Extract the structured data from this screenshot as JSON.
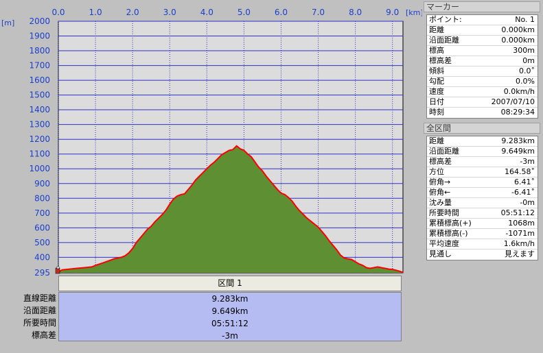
{
  "chart_data": {
    "type": "area",
    "title": "",
    "xlabel": "[km]",
    "ylabel": "[m]",
    "xlim": [
      0,
      9.283
    ],
    "ylim": [
      295,
      2000
    ],
    "x_ticks": [
      0.0,
      1.0,
      2.0,
      3.0,
      4.0,
      5.0,
      6.0,
      7.0,
      8.0,
      9.0
    ],
    "x_tick_labels": [
      "0.0",
      "1.0",
      "2.0",
      "3.0",
      "4.0",
      "5.0",
      "6.0",
      "7.0",
      "8.0",
      "9.0"
    ],
    "y_ticks": [
      295,
      400,
      500,
      600,
      700,
      800,
      900,
      1000,
      1100,
      1200,
      1300,
      1400,
      1500,
      1600,
      1700,
      1800,
      1900,
      2000
    ],
    "y_tick_labels": [
      "295",
      "400",
      "500",
      "600",
      "700",
      "800",
      "900",
      "1000",
      "1100",
      "1200",
      "1300",
      "1400",
      "1500",
      "1600",
      "1700",
      "1800",
      "1900",
      "2000"
    ],
    "grid": true,
    "fill_color": "#5e8f32",
    "line_color": "#ff0000",
    "series": [
      {
        "x": [
          0.0,
          0.1,
          0.3,
          0.5,
          0.7,
          0.9,
          1.0,
          1.2,
          1.4,
          1.5,
          1.6,
          1.7,
          1.8,
          1.9,
          2.0,
          2.1,
          2.2,
          2.3,
          2.4,
          2.5,
          2.6,
          2.7,
          2.8,
          2.9,
          3.0,
          3.1,
          3.2,
          3.3,
          3.4,
          3.5,
          3.6,
          3.7,
          3.8,
          3.9,
          4.0,
          4.1,
          4.2,
          4.3,
          4.4,
          4.5,
          4.6,
          4.7,
          4.8,
          4.9,
          5.0,
          5.1,
          5.2,
          5.3,
          5.4,
          5.5,
          5.6,
          5.7,
          5.8,
          5.9,
          6.0,
          6.1,
          6.2,
          6.3,
          6.4,
          6.5,
          6.6,
          6.7,
          6.8,
          6.9,
          7.0,
          7.1,
          7.2,
          7.3,
          7.4,
          7.5,
          7.6,
          7.7,
          7.8,
          7.9,
          8.0,
          8.1,
          8.2,
          8.3,
          8.4,
          8.5,
          8.6,
          8.7,
          8.8,
          8.9,
          9.0,
          9.1,
          9.2,
          9.283
        ],
        "y": [
          300,
          315,
          320,
          325,
          330,
          335,
          345,
          362,
          380,
          390,
          395,
          400,
          410,
          430,
          460,
          500,
          530,
          560,
          590,
          610,
          640,
          665,
          690,
          720,
          760,
          795,
          815,
          825,
          830,
          860,
          890,
          925,
          950,
          975,
          1000,
          1025,
          1045,
          1070,
          1095,
          1110,
          1125,
          1130,
          1155,
          1135,
          1125,
          1100,
          1080,
          1045,
          1010,
          985,
          950,
          920,
          890,
          860,
          835,
          825,
          805,
          780,
          745,
          715,
          690,
          665,
          645,
          625,
          605,
          575,
          545,
          510,
          480,
          450,
          415,
          395,
          390,
          385,
          370,
          355,
          345,
          330,
          325,
          330,
          335,
          330,
          325,
          320,
          318,
          312,
          305,
          297
        ]
      }
    ]
  },
  "section": {
    "header": "区間 1",
    "rows": [
      {
        "label": "直線距離",
        "value": "9.283km"
      },
      {
        "label": "沿面距離",
        "value": "9.649km"
      },
      {
        "label": "所要時間",
        "value": "05:51:12"
      },
      {
        "label": "標高差",
        "value": "-3m"
      }
    ]
  },
  "marker": {
    "title": "マーカー",
    "rows": [
      {
        "label": "ポイント:",
        "value": "No. 1"
      },
      {
        "label": "距離",
        "value": "0.000km"
      },
      {
        "label": "沿面距離",
        "value": "0.000km"
      },
      {
        "label": "標高",
        "value": "300m"
      },
      {
        "label": "標高差",
        "value": "0m"
      },
      {
        "label": "傾斜",
        "value": "0.0˚"
      },
      {
        "label": "勾配",
        "value": "0.0%"
      },
      {
        "label": "速度",
        "value": "0.0km/h"
      },
      {
        "label": "日付",
        "value": "2007/07/10"
      },
      {
        "label": "時刻",
        "value": "08:29:34"
      }
    ]
  },
  "total": {
    "title": "全区間",
    "rows": [
      {
        "label": "距離",
        "value": "9.283km"
      },
      {
        "label": "沿面距離",
        "value": "9.649km"
      },
      {
        "label": "標高差",
        "value": "-3m"
      },
      {
        "label": "方位",
        "value": "164.58˚"
      },
      {
        "label": "俯角→",
        "value": "6.41˚"
      },
      {
        "label": "俯角←",
        "value": "-6.41˚"
      },
      {
        "label": "沈み量",
        "value": "-0m"
      },
      {
        "label": "所要時間",
        "value": "05:51:12"
      },
      {
        "label": "累積標高(+)",
        "value": "1068m"
      },
      {
        "label": "累積標高(-)",
        "value": "-1071m"
      },
      {
        "label": "平均速度",
        "value": "1.6km/h"
      },
      {
        "label": "見通し",
        "value": "見えます"
      }
    ]
  }
}
